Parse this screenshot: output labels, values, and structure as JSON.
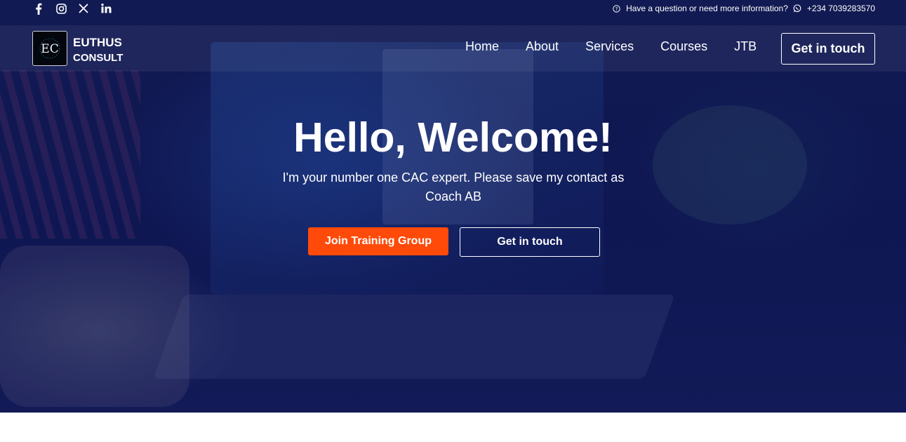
{
  "topbar": {
    "social": [
      {
        "icon": "facebook-icon"
      },
      {
        "icon": "instagram-icon"
      },
      {
        "icon": "x-twitter-icon"
      },
      {
        "icon": "linkedin-icon"
      }
    ],
    "question_text": "Have a question or need more information?",
    "phone": "+234 7039283570"
  },
  "navbar": {
    "logo_text": "EC",
    "brand_line1": "EUTHUS",
    "brand_line2": "CONSULT",
    "links": [
      "Home",
      "About",
      "Services",
      "Courses",
      "JTB"
    ],
    "cta_label": "Get in touch"
  },
  "hero": {
    "headline": "Hello, Welcome!",
    "subtext": "I'm your number one CAC expert. Please save my contact as Coach AB",
    "primary_button": "Join Training Group",
    "secondary_button": "Get in touch"
  },
  "colors": {
    "hero_overlay": "#111a52",
    "accent": "#ff4a0a",
    "text": "#ffffff",
    "page_background": "#ffffff"
  }
}
